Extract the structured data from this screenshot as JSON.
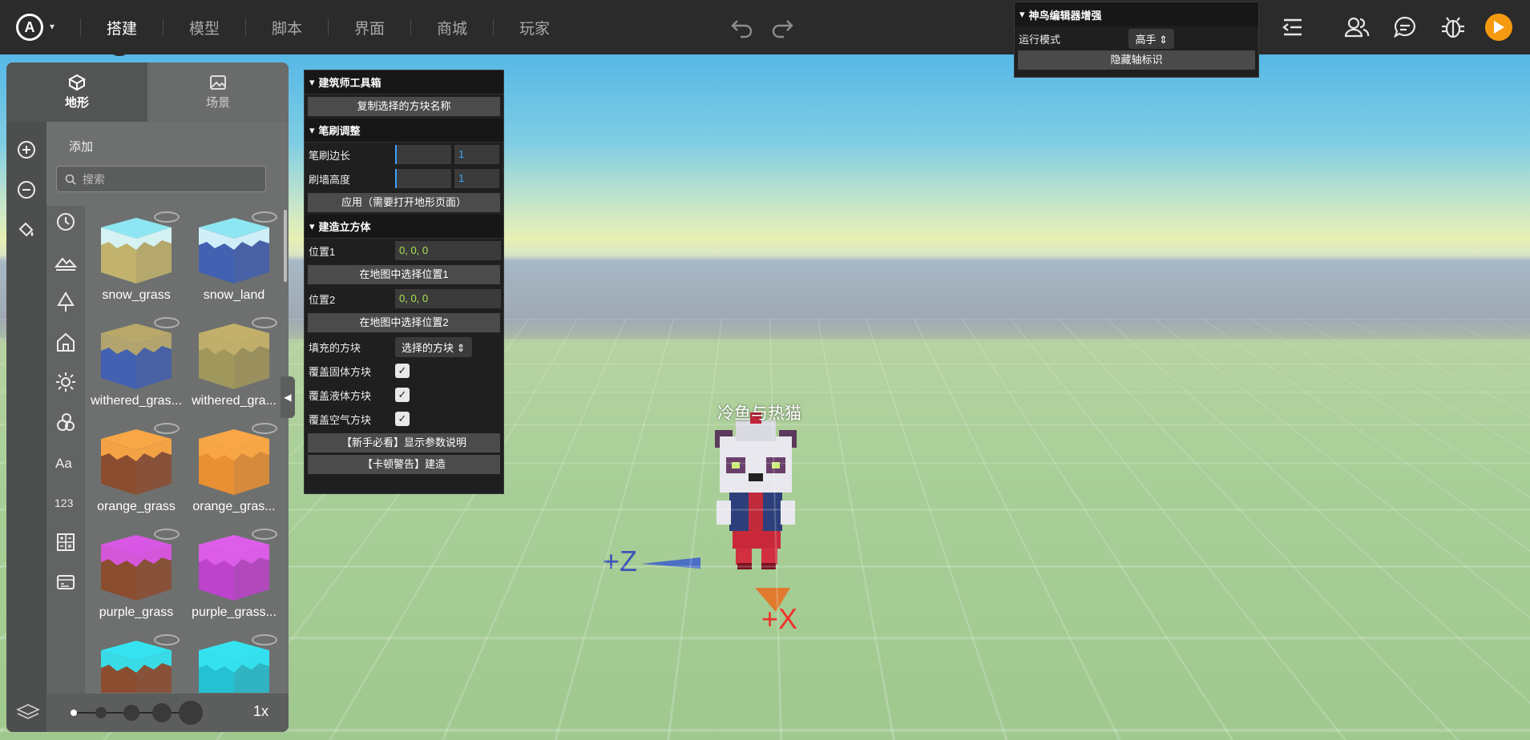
{
  "topbar": {
    "logo_letter": "A",
    "nav": [
      "搭建",
      "模型",
      "脚本",
      "界面",
      "商城",
      "玩家"
    ],
    "active_index": 0
  },
  "enhancer": {
    "title": "神鸟编辑器增强",
    "run_mode_label": "运行模式",
    "run_mode_value": "高手",
    "hide_axis_button": "隐藏轴标识"
  },
  "left_panel": {
    "tabs": [
      "地形",
      "场景"
    ],
    "add_label": "添加",
    "search_placeholder": "搜索",
    "blocks": [
      {
        "label": "snow_grass",
        "top": "#8ee6f2",
        "side": "#c9b86d",
        "drip": "#d7f6fb"
      },
      {
        "label": "snow_land",
        "top": "#8ee6f2",
        "side": "#3f5fb5",
        "drip": "#d7f6fb"
      },
      {
        "label": "withered_gras...",
        "top": "#b8a86a",
        "side": "#3f5fb5",
        "drip": "#b8a86a"
      },
      {
        "label": "withered_gra...",
        "top": "#c2b06a",
        "side": "#a59a5a",
        "drip": "#c2b06a"
      },
      {
        "label": "orange_grass",
        "top": "#f9a646",
        "side": "#8e4a2a",
        "drip": "#f9a646"
      },
      {
        "label": "orange_gras...",
        "top": "#f9a646",
        "side": "#f3922e",
        "drip": "#f9a646"
      },
      {
        "label": "purple_grass",
        "top": "#d857e4",
        "side": "#8e4a2a",
        "drip": "#d857e4"
      },
      {
        "label": "purple_grass...",
        "top": "#dd5ee8",
        "side": "#c43fd4",
        "drip": "#dd5ee8"
      },
      {
        "label": "",
        "top": "#35e3f0",
        "side": "#8e4a2a",
        "drip": "#35e3f0"
      },
      {
        "label": "",
        "top": "#35e3f0",
        "side": "#1fc8da",
        "drip": "#35e3f0"
      }
    ],
    "zoom": "1x"
  },
  "toolbox": {
    "title": "建筑师工具箱",
    "copy_button": "复制选择的方块名称",
    "brush_title": "笔刷调整",
    "brush_size_label": "笔刷边长",
    "brush_size_value": "1",
    "brush_height_label": "刷墙高度",
    "brush_height_value": "1",
    "apply_button": "应用（需要打开地形页面）",
    "cube_title": "建造立方体",
    "pos1_label": "位置1",
    "pos1_value": "0, 0, 0",
    "pick_pos1_button": "在地图中选择位置1",
    "pos2_label": "位置2",
    "pos2_value": "0, 0, 0",
    "pick_pos2_button": "在地图中选择位置2",
    "fill_label": "填充的方块",
    "fill_value": "选择的方块",
    "cover_solid_label": "覆盖固体方块",
    "cover_liquid_label": "覆盖液体方块",
    "cover_air_label": "覆盖空气方块",
    "help_button": "【新手必看】显示参数说明",
    "build_button": "【卡顿警告】建造"
  },
  "scene": {
    "character_name": "冷鱼与热猫",
    "axis_z": "+Z",
    "axis_x": "+X"
  }
}
